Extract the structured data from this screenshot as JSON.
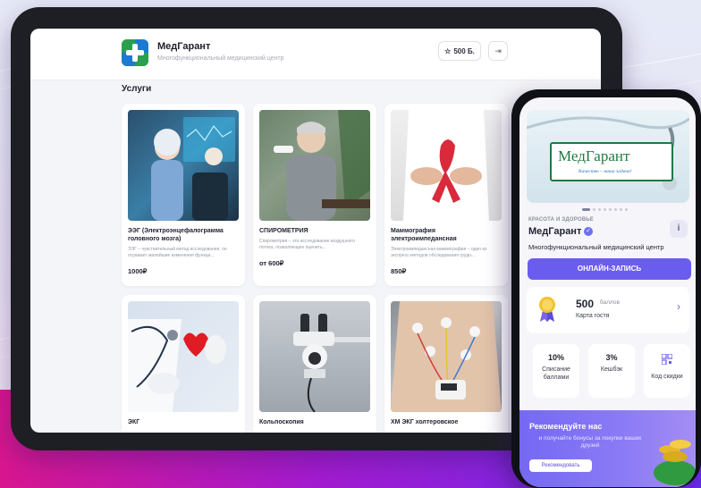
{
  "colors": {
    "accent": "#6b5cf0",
    "brand_green": "#2aa04f",
    "brand_blue": "#1c7bd0",
    "background_band": "#a41bd0"
  },
  "tablet": {
    "header": {
      "brand_name": "МедГарант",
      "brand_subtitle": "Многофункциональный медицинский центр",
      "points_label": "500 Б.",
      "points_icon": "star-icon",
      "exit_icon": "logout-icon"
    },
    "section_title": "Услуги",
    "services": [
      {
        "title": "ЭЭГ (Электроэнцефалограмма головного мозга)",
        "desc": "ЭЭГ – чувствительный метод исследования, он отражает малейшие изменения функци...",
        "price": "1000₽",
        "image": "eeg-photo"
      },
      {
        "title": "СПИРОМЕТРИЯ",
        "desc": "Спирометрия – это исследование воздушного потока, позволяющее оценить...",
        "price": "от 600₽",
        "image": "spirometry-photo"
      },
      {
        "title": "Маммография электроимпедансная",
        "desc": "Электроимпедансная маммография – один из экспресс-методов обследования грудн...",
        "price": "850₽",
        "image": "mammography-photo"
      },
      {
        "title": "ЭКГ",
        "desc": "",
        "price": "",
        "image": "ekg-photo"
      },
      {
        "title": "Кольпоскопия",
        "desc": "",
        "price": "",
        "image": "colposcopy-photo"
      },
      {
        "title": "ХМ ЭКГ холтеровское",
        "desc": "",
        "price": "",
        "image": "holter-photo"
      }
    ]
  },
  "phone": {
    "banner": {
      "sign_name": "МедГарант",
      "sign_tagline": "Качество – наша задача!"
    },
    "carousel_count": 8,
    "carousel_active": 0,
    "category": "КРАСОТА И ЗДОРОВЬЕ",
    "name": "МедГарант",
    "description": "Многофункциональный медицинский центр",
    "book_button": "ОНЛАЙН-ЗАПИСЬ",
    "loyalty": {
      "points": "500",
      "points_unit": "баллов",
      "card_name": "Карта гостя"
    },
    "tiles": [
      {
        "value": "10%",
        "label": "Списание баллами"
      },
      {
        "value": "3%",
        "label": "Кешбэк"
      },
      {
        "value": "",
        "label": "Код скидки",
        "icon": "qr-code-icon"
      }
    ],
    "refer": {
      "title": "Рекомендуйте нас",
      "subtitle": "и получайте бонусы за покупки ваших друзей",
      "button": "Рекомендовать"
    }
  }
}
